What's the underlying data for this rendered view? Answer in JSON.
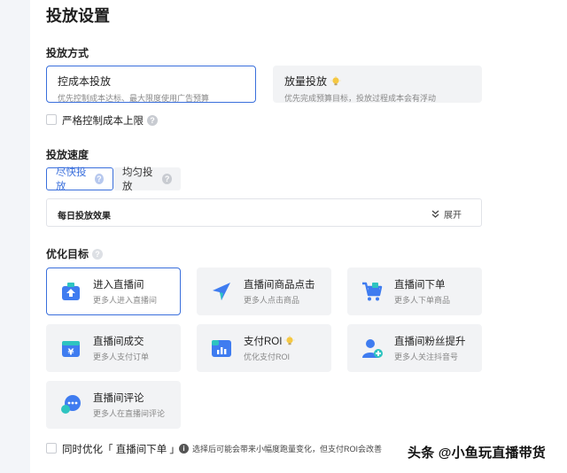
{
  "page_title": "投放设置",
  "delivery_method": {
    "label": "投放方式",
    "options": [
      {
        "title": "控成本投放",
        "desc": "优先控制成本达标、最大限度使用广告预算",
        "selected": true
      },
      {
        "title": "放量投放",
        "desc": "优先完成预算目标，投放过程成本会有浮动",
        "selected": false
      }
    ],
    "strict_cost_label": "严格控制成本上限"
  },
  "delivery_speed": {
    "label": "投放速度",
    "options": [
      {
        "label": "尽快投放",
        "selected": true
      },
      {
        "label": "均匀投放",
        "selected": false
      }
    ]
  },
  "daily_effect": {
    "title": "每日投放效果",
    "expand_label": "展开"
  },
  "optimization_goal": {
    "label": "优化目标",
    "items": [
      {
        "title": "进入直播间",
        "desc": "更多人进入直播间",
        "icon": "live-room-enter-icon",
        "selected": true
      },
      {
        "title": "直播间商品点击",
        "desc": "更多人点击商品",
        "icon": "cursor-click-icon",
        "selected": false
      },
      {
        "title": "直播间下单",
        "desc": "更多人下单商品",
        "icon": "shopping-cart-icon",
        "selected": false
      },
      {
        "title": "直播间成交",
        "desc": "更多人支付订单",
        "icon": "yuan-payment-icon",
        "selected": false
      },
      {
        "title": "支付ROI",
        "desc": "优化支付ROI",
        "icon": "roi-chart-icon",
        "selected": false
      },
      {
        "title": "直播间粉丝提升",
        "desc": "更多人关注抖音号",
        "icon": "add-follower-icon",
        "selected": false
      },
      {
        "title": "直播间评论",
        "desc": "更多人在直播间评论",
        "icon": "comment-bubble-icon",
        "selected": false
      }
    ]
  },
  "co_optimize": {
    "label": "同时优化「 直播间下单 」",
    "note": "选择后可能会带来小幅度跑量变化，但支付ROI会改善"
  },
  "watermark": "头条 @小鱼玩直播带货",
  "colors": {
    "accent": "#3a6fdc",
    "card_bg": "#f2f3f5",
    "icon_blue": "#3f7cf0",
    "icon_teal": "#2ec4c0"
  }
}
